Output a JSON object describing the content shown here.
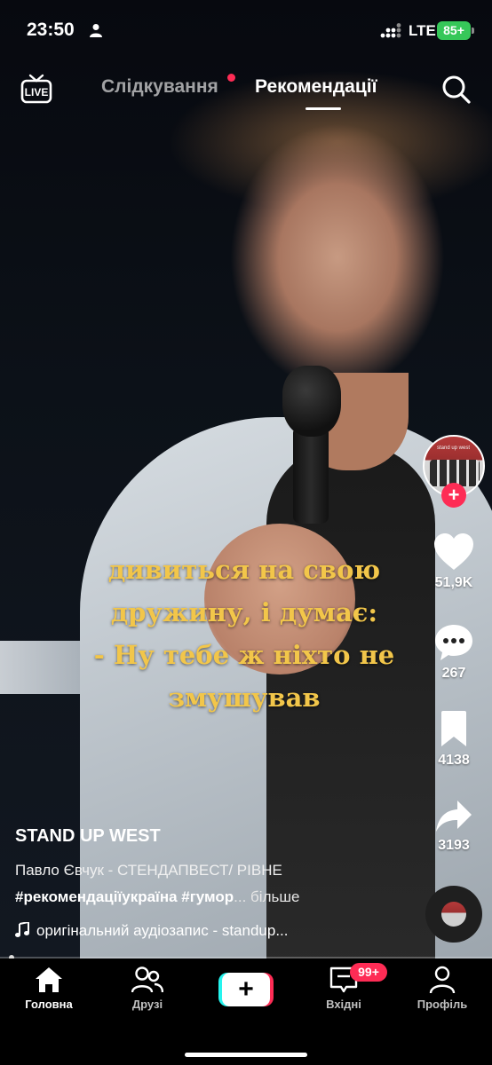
{
  "status_bar": {
    "time": "23:50",
    "network": "LTE",
    "battery": "85+"
  },
  "top_nav": {
    "live_label": "LIVE",
    "tabs": [
      {
        "label": "Слідкування",
        "active": false,
        "has_dot": true
      },
      {
        "label": "Рекомендації",
        "active": true
      }
    ],
    "search_icon": "search-icon"
  },
  "video": {
    "caption_lines": [
      "дивиться на свою",
      "дружину, і думає:",
      "- Ну тебе ж ніхто не",
      "змушував"
    ],
    "caption_color": "#f2c64a"
  },
  "right_rail": {
    "avatar_text": "stand up west",
    "likes": "51,9K",
    "comments": "267",
    "saves": "4138",
    "shares": "3193"
  },
  "post": {
    "author": "STAND UP WEST",
    "description": "Павло Євчук - СТЕНДАПВЕСТ/ РІВНЕ",
    "hashtags": "#рекомендаціїукраїна #гумор",
    "more": "... більше",
    "music": "оригінальний аудіозапис - standup..."
  },
  "bottom_nav": {
    "items": [
      {
        "label": "Головна",
        "icon": "home-icon",
        "active": true
      },
      {
        "label": "Друзі",
        "icon": "friends-icon",
        "active": false
      },
      {
        "label": "",
        "icon": "create-icon",
        "active": false
      },
      {
        "label": "Вхідні",
        "icon": "inbox-icon",
        "active": false
      },
      {
        "label": "Профіль",
        "icon": "profile-icon",
        "active": false
      }
    ],
    "create_symbol": "+",
    "inbox_badge": "99+"
  },
  "colors": {
    "accent": "#fe2c55",
    "accent_cyan": "#25f4ee",
    "battery": "#36c759"
  }
}
